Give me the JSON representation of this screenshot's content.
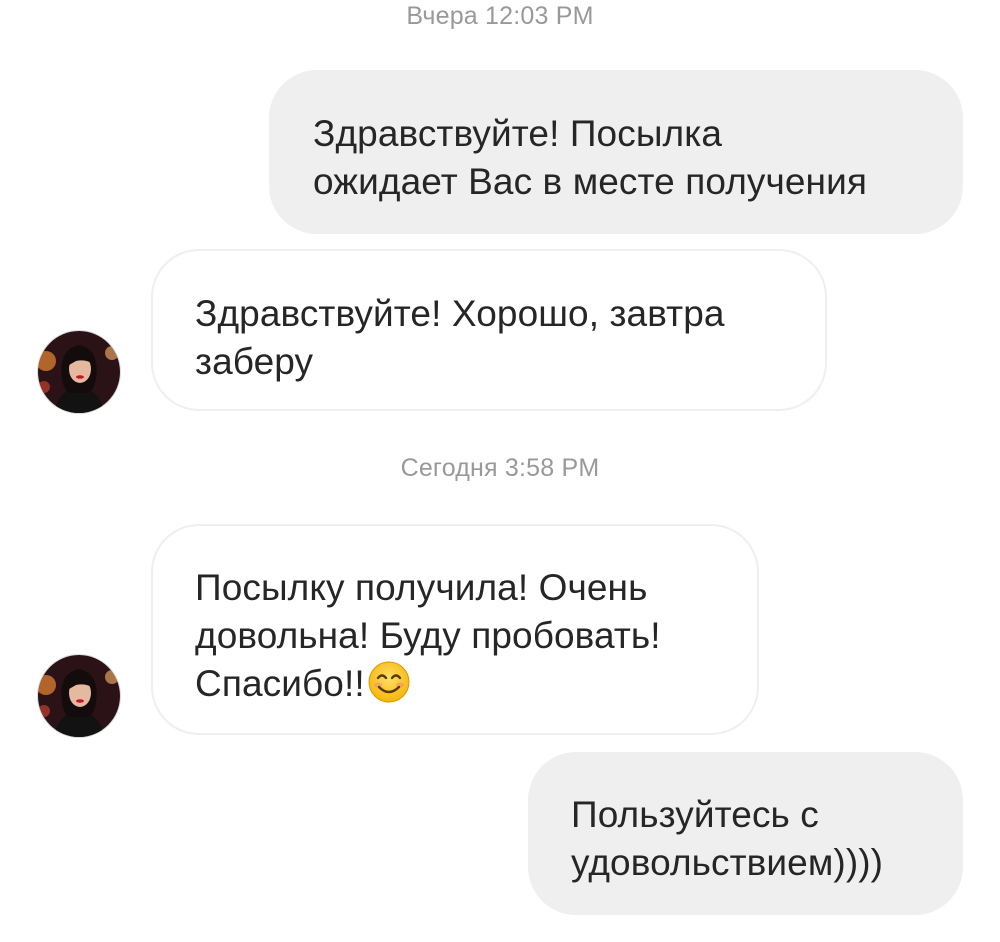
{
  "conversation": {
    "timestamps": [
      "Вчера 12:03 PM",
      "Сегодня 3:58 PM"
    ],
    "messages": [
      {
        "direction": "outgoing",
        "lines": [
          "Здравствуйте! Посылка",
          "ожидает Вас в месте получения"
        ]
      },
      {
        "direction": "incoming",
        "lines": [
          "Здравствуйте! Хорошо, завтра",
          "заберу"
        ]
      },
      {
        "direction": "incoming",
        "lines": [
          "Посылку получила! Очень",
          "довольна! Буду пробовать!",
          "Спасибо!!"
        ],
        "trailing_icon": "smiling-face-emoji"
      },
      {
        "direction": "outgoing",
        "lines": [
          "Пользуйтесь с",
          "удовольствием))))"
        ]
      }
    ]
  },
  "colors": {
    "outgoing_bubble": "#efefef",
    "incoming_border": "#efefef",
    "text": "#262626",
    "timestamp": "#999999"
  }
}
